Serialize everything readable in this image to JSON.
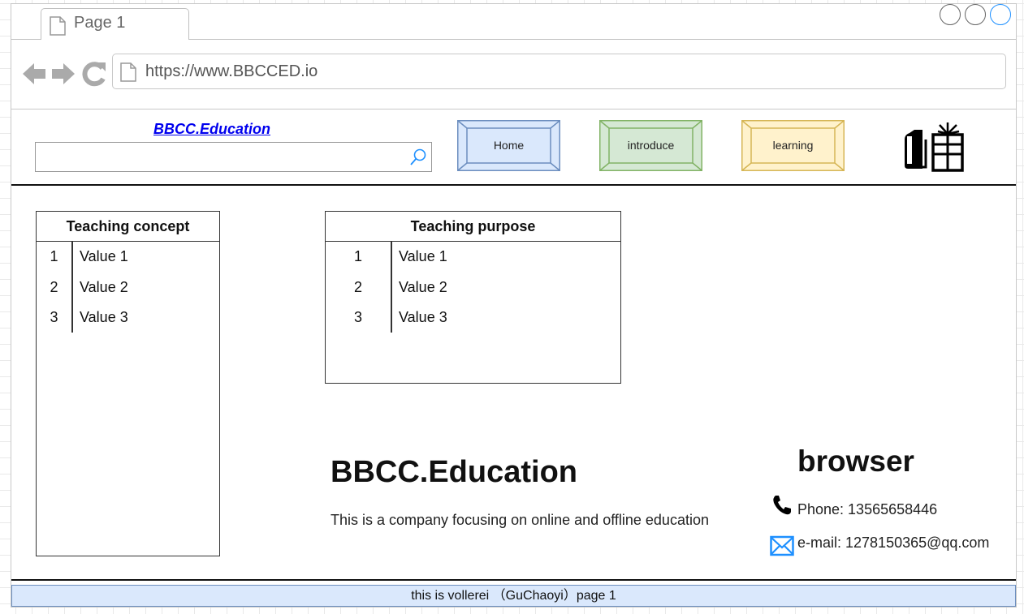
{
  "browser": {
    "tab_label": "Page 1",
    "url": "https://www.BBCCED.io"
  },
  "header": {
    "brand_link": "BBCC.Education",
    "search": {
      "value": "",
      "placeholder": ""
    },
    "nav": {
      "home": {
        "label": "Home",
        "fill": "#dae8fc",
        "stroke": "#6c8ebf"
      },
      "introduce": {
        "label": "introduce",
        "fill": "#d5e8d4",
        "stroke": "#82b366"
      },
      "learning": {
        "label": "learning",
        "fill": "#fff2cc",
        "stroke": "#d6b656"
      }
    }
  },
  "tables": {
    "concept": {
      "title": "Teaching concept",
      "rows": [
        {
          "num": "1",
          "value": "Value 1"
        },
        {
          "num": "2",
          "value": "Value 2"
        },
        {
          "num": "3",
          "value": "Value 3"
        }
      ]
    },
    "purpose": {
      "title": "Teaching purpose",
      "rows": [
        {
          "num": "1",
          "value": "Value 1"
        },
        {
          "num": "2",
          "value": "Value 2"
        },
        {
          "num": "3",
          "value": "Value 3"
        }
      ]
    }
  },
  "company": {
    "title": "BBCC.Education",
    "description": "This is a company focusing on online and offline education"
  },
  "contact": {
    "title": "browser",
    "phone": "Phone:  13565658446",
    "email": "e-mail: 1278150365@qq.com"
  },
  "footer": {
    "text": "this is vollerei  （GuChaoyi）page 1"
  },
  "colors": {
    "link": "#0000ee",
    "accent": "#1e90ff",
    "footer_fill": "#dae8fc"
  },
  "icons": [
    "document-icon",
    "back-arrow-icon",
    "forward-arrow-icon",
    "refresh-icon",
    "search-icon",
    "book-gift-logo-icon",
    "phone-icon",
    "mail-icon"
  ]
}
